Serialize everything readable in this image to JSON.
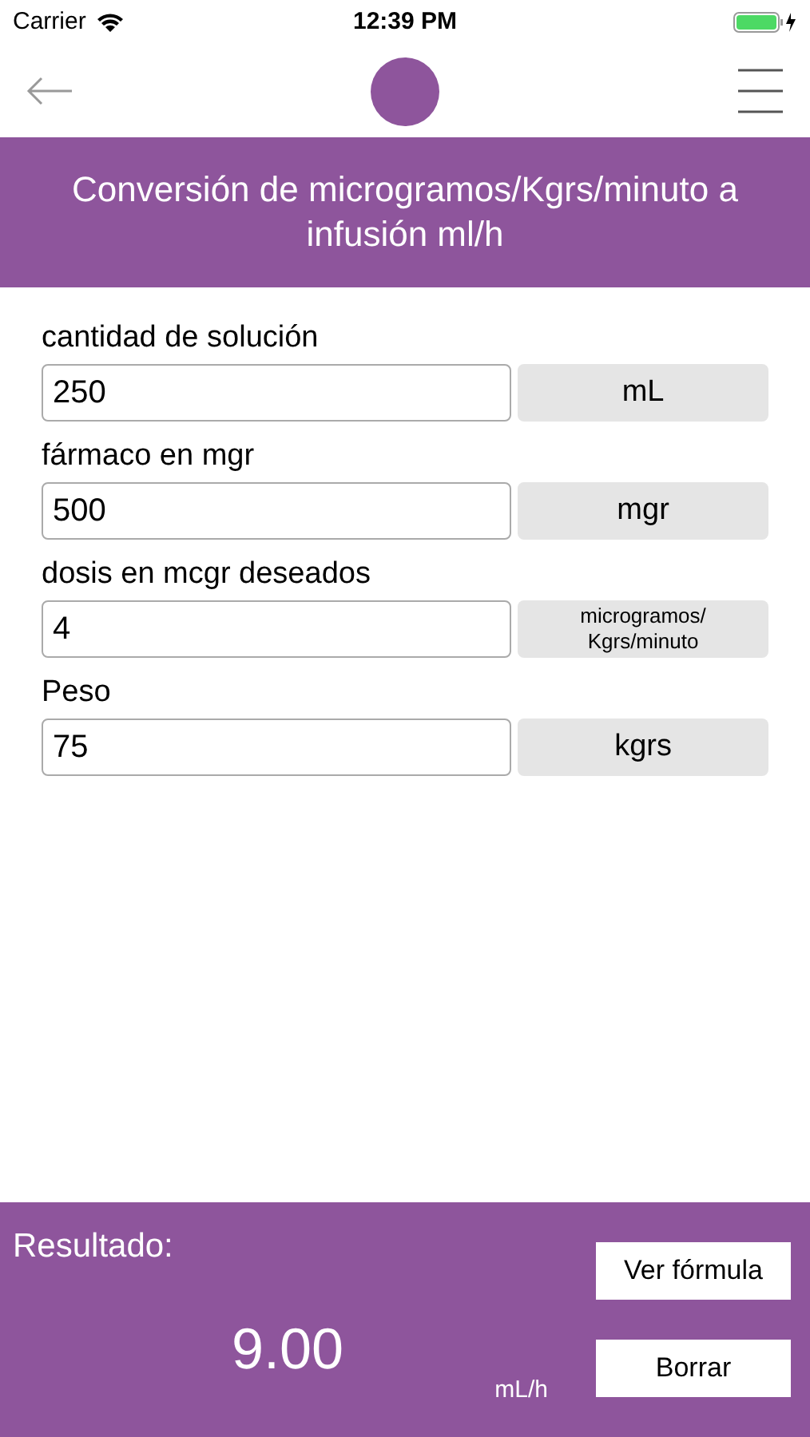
{
  "status_bar": {
    "carrier": "Carrier",
    "time": "12:39 PM"
  },
  "header": {
    "title": "Conversión de microgramos/Kgrs/minuto a infusión ml/h"
  },
  "fields": [
    {
      "label": "cantidad de solución",
      "value": "250",
      "unit": "mL"
    },
    {
      "label": "fármaco en mgr",
      "value": "500",
      "unit": "mgr"
    },
    {
      "label": "dosis en mcgr deseados",
      "value": "4",
      "unit": "microgramos/\nKgrs/minuto"
    },
    {
      "label": "Peso",
      "value": "75",
      "unit": "kgrs"
    }
  ],
  "result": {
    "label": "Resultado:",
    "value": "9.00",
    "unit": "mL/h",
    "buttons": [
      "Ver fórmula",
      "Borrar"
    ]
  }
}
